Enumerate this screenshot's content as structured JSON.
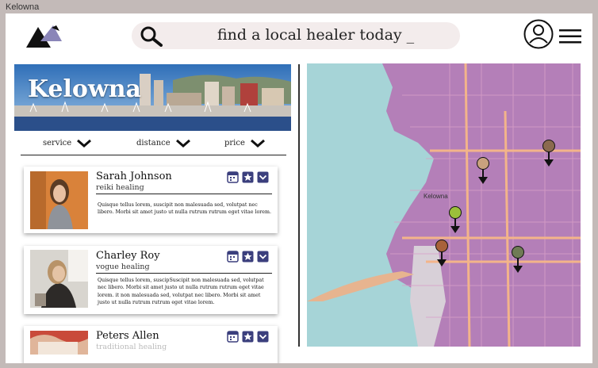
{
  "window": {
    "title": "Kelowna"
  },
  "header": {
    "search_placeholder": "find a local healer today _",
    "icons": [
      "logo-mountains",
      "search-icon",
      "user-avatar-icon",
      "hamburger-menu-icon"
    ]
  },
  "hero": {
    "city": "Kelowna"
  },
  "filters": [
    {
      "label": "service"
    },
    {
      "label": "distance"
    },
    {
      "label": "price"
    }
  ],
  "healers": [
    {
      "name": "Sarah Johnson",
      "service": "reiki healing",
      "description": "Quisque tellus lorem, suscipit non malesuada sed, volutpat nec libero. Morbi sit amet justo ut nulla rutrum rutrum eget vitae lorem."
    },
    {
      "name": "Charley Roy",
      "service": "vogue healing",
      "description": "Quisque tellus lorem, suscipSuscipit non malesuada sed, volutpat nec libero. Morbi sit amet justo ut nulla rutrum rutrum eget vitae lorem. it non malesuada sed, volutpat nec libero. Morbi sit amet justo ut nulla rutrum rutrum eget vitae lorem."
    },
    {
      "name": "Peters Allen",
      "service": "traditional healing",
      "description": ""
    }
  ],
  "map": {
    "label": "Kelowna"
  },
  "colors": {
    "map_land": "#b47fb8",
    "map_water": "#a6d4d7",
    "action_icon": "#3b3f7d",
    "search_bg": "#f3ecec"
  }
}
